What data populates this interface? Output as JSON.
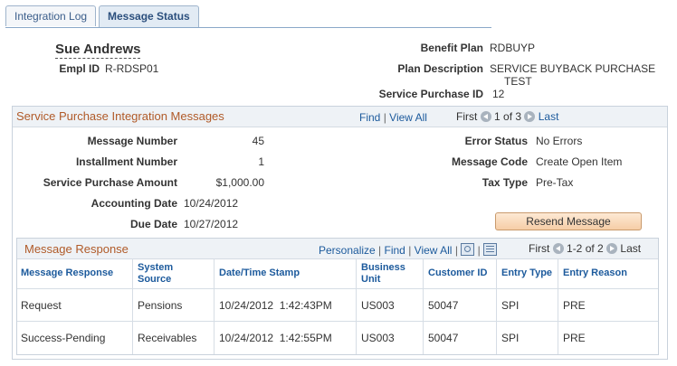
{
  "tabs": [
    {
      "label": "Integration Log",
      "active": false
    },
    {
      "label": "Message Status",
      "active": true
    }
  ],
  "employee": {
    "name": "Sue Andrews",
    "empl_id_label": "Empl ID",
    "empl_id": "R-RDSP01"
  },
  "plan": {
    "benefit_plan_label": "Benefit Plan",
    "benefit_plan": "RDBUYP",
    "plan_description_label": "Plan Description",
    "plan_description_line1": "SERVICE BUYBACK PURCHASE",
    "plan_description_line2": "TEST",
    "service_purchase_id_label": "Service Purchase ID",
    "service_purchase_id": "12"
  },
  "messages_group": {
    "title": "Service Purchase Integration Messages",
    "find": "Find",
    "view_all": "View All",
    "first": "First",
    "range": "1 of 3",
    "last": "Last",
    "fields": {
      "message_number_label": "Message Number",
      "message_number": "45",
      "installment_number_label": "Installment Number",
      "installment_number": "1",
      "service_purchase_amount_label": "Service Purchase Amount",
      "service_purchase_amount": "$1,000.00",
      "accounting_date_label": "Accounting Date",
      "accounting_date": "10/24/2012",
      "due_date_label": "Due Date",
      "due_date": "10/27/2012",
      "error_status_label": "Error Status",
      "error_status": "No Errors",
      "message_code_label": "Message Code",
      "message_code": "Create Open Item",
      "tax_type_label": "Tax Type",
      "tax_type": "Pre-Tax"
    },
    "resend_button": "Resend Message"
  },
  "response_grid": {
    "title": "Message Response",
    "personalize": "Personalize",
    "find": "Find",
    "view_all": "View All",
    "first": "First",
    "range": "1-2 of 2",
    "last": "Last",
    "columns": {
      "message_response": "Message Response",
      "system_source_1": "System",
      "system_source_2": "Source",
      "timestamp": "Date/Time Stamp",
      "business_unit_1": "Business",
      "business_unit_2": "Unit",
      "customer_id": "Customer ID",
      "entry_type": "Entry Type",
      "entry_reason": "Entry Reason"
    },
    "rows": [
      {
        "message_response": "Request",
        "system_source": "Pensions",
        "timestamp": "10/24/2012  1:42:43PM",
        "business_unit": "US003",
        "customer_id": "50047",
        "entry_type": "SPI",
        "entry_reason": "PRE"
      },
      {
        "message_response": "Success-Pending",
        "system_source": "Receivables",
        "timestamp": "10/24/2012  1:42:55PM",
        "business_unit": "US003",
        "customer_id": "50047",
        "entry_type": "SPI",
        "entry_reason": "PRE"
      }
    ]
  }
}
